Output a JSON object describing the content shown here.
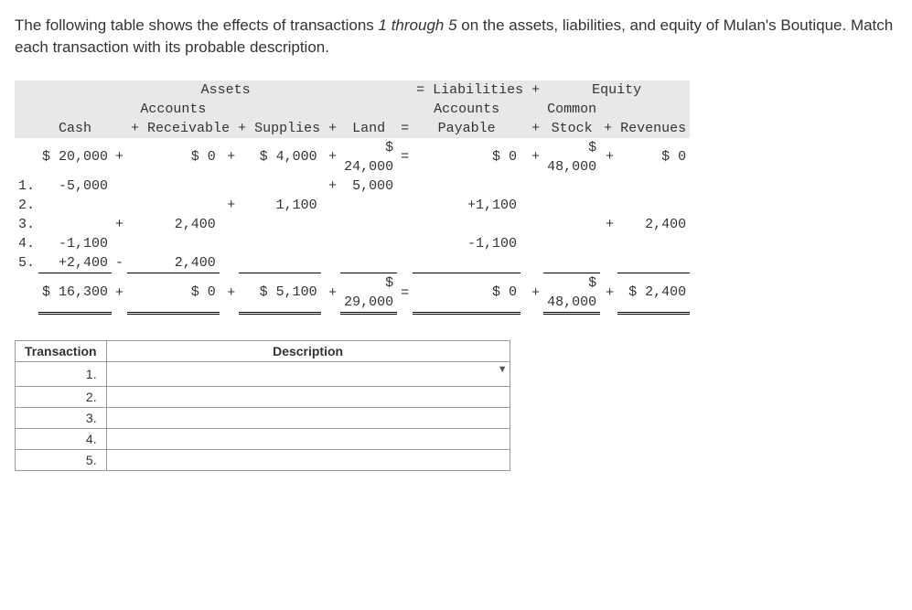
{
  "prompt": {
    "part1": "The following table shows the effects of transactions ",
    "range": "1 through 5",
    "part2": " on the assets, liabilities, and equity of Mulan's Boutique. Match each transaction with its probable description."
  },
  "headers": {
    "assets": "Assets",
    "liabilities_plus": "= Liabilities +",
    "equity": "Equity",
    "cash": "Cash",
    "accounts_receivable_top": "Accounts",
    "accounts_receivable_bot": "+ Receivable + Supplies +",
    "supplies": "",
    "land": "Land",
    "eq": "=",
    "accounts_payable_top": "Accounts",
    "accounts_payable_bot": "Payable",
    "plus": "+",
    "common_stock_top": "Common",
    "common_stock_bot": "Stock",
    "revenues": "+ Revenues"
  },
  "initial": {
    "cash": "$ 20,000",
    "ar": "$ 0",
    "supplies": "$ 4,000",
    "land_top": "$",
    "land": "24,000",
    "ap": "$ 0",
    "stock_top": "$",
    "stock": "48,000",
    "rev": "$ 0",
    "plus": "+",
    "eq": "="
  },
  "rows": [
    {
      "num": "1.",
      "cash": "-5,000",
      "ar": "",
      "supplies": "",
      "land": "5,000",
      "ap": "",
      "stock": "",
      "rev": "",
      "op_land": "+"
    },
    {
      "num": "2.",
      "cash": "",
      "ar": "",
      "supplies": "1,100",
      "land": "",
      "ap": "+1,100",
      "stock": "",
      "rev": "",
      "op_sup": "+"
    },
    {
      "num": "3.",
      "cash": "",
      "ar": "2,400",
      "supplies": "",
      "land": "",
      "ap": "",
      "stock": "",
      "rev": "2,400",
      "op_ar": "+",
      "op_rev": "+"
    },
    {
      "num": "4.",
      "cash": "-1,100",
      "ar": "",
      "supplies": "",
      "land": "",
      "ap": "-1,100",
      "stock": "",
      "rev": ""
    },
    {
      "num": "5.",
      "cash": "+2,400",
      "ar": "2,400",
      "supplies": "",
      "land": "",
      "ap": "",
      "stock": "",
      "rev": "",
      "op_cash_ar": "-"
    }
  ],
  "totals": {
    "cash": "$ 16,300",
    "ar": "$ 0",
    "supplies": "$ 5,100",
    "land_top": "$",
    "land": "29,000",
    "ap": "$ 0",
    "stock_top": "$",
    "stock": "48,000",
    "rev": "$ 2,400",
    "plus": "+",
    "eq": "="
  },
  "match": {
    "th_transaction": "Transaction",
    "th_description": "Description",
    "rows": [
      "1.",
      "2.",
      "3.",
      "4.",
      "5."
    ]
  }
}
